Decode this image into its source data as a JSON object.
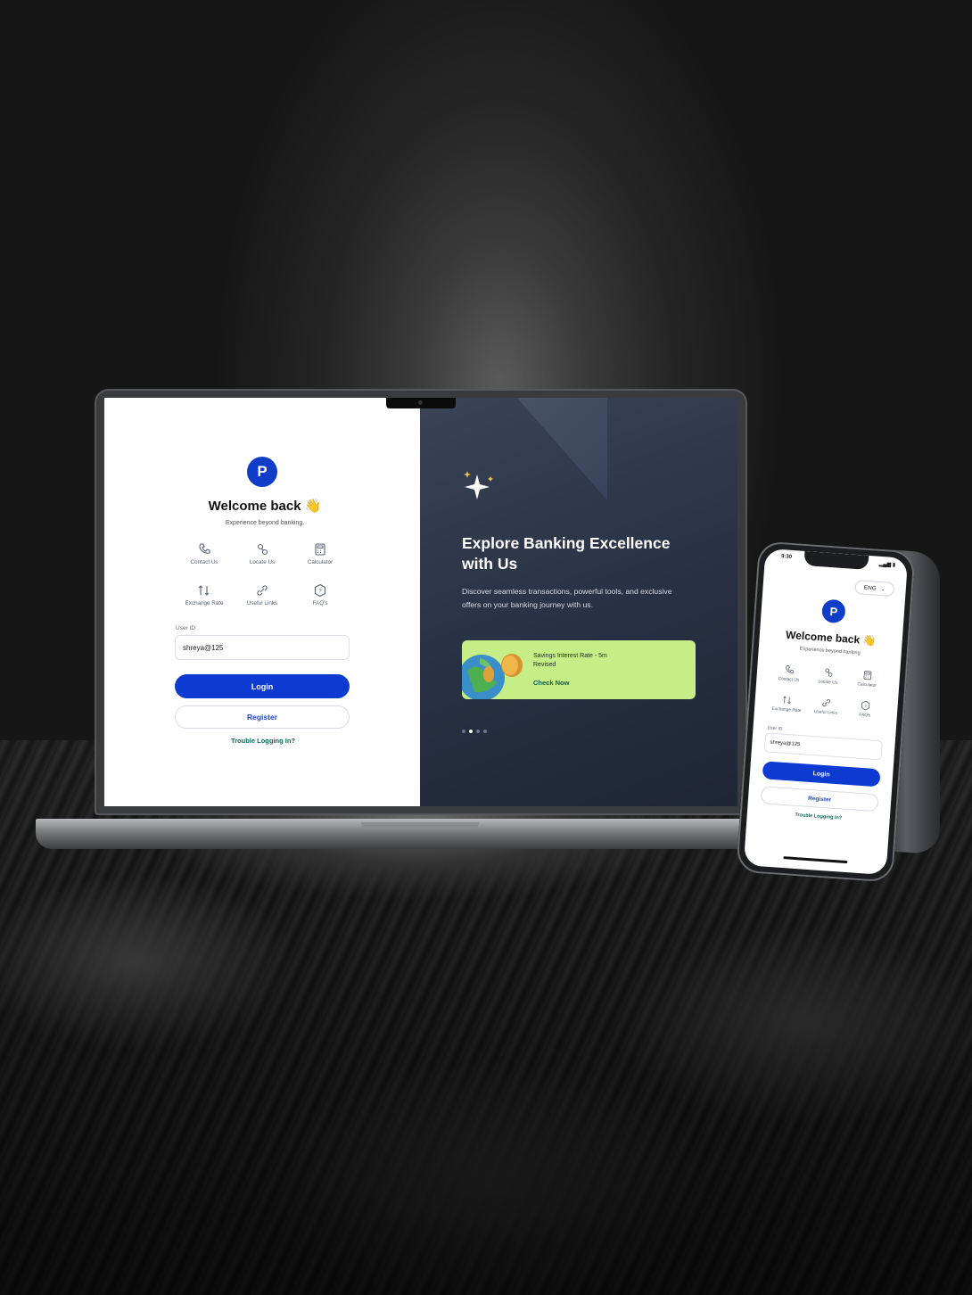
{
  "laptop": {
    "login": {
      "welcome": "Welcome back",
      "wave": "👋",
      "subtitle": "Experience beyond banking.",
      "quick_actions": [
        {
          "label": "Contact Us",
          "icon": "phone-icon"
        },
        {
          "label": "Locate Us",
          "icon": "location-icon"
        },
        {
          "label": "Calculator",
          "icon": "calculator-icon"
        },
        {
          "label": "Exchange Rate",
          "icon": "exchange-icon"
        },
        {
          "label": "Useful Links",
          "icon": "link-icon"
        },
        {
          "label": "FAQ's",
          "icon": "faq-icon"
        }
      ],
      "user_id_label": "User ID",
      "user_id_value": "shreya@125",
      "login_label": "Login",
      "register_label": "Register",
      "trouble_label": "Trouble Logging In?"
    },
    "promo": {
      "title": "Explore Banking Excellence with Us",
      "description": "Discover seamless transactions, powerful tools, and exclusive offers on your banking journey with us.",
      "banner_text": "Savings Interest Rate - 5m Revised",
      "banner_link": "Check Now",
      "dots": 4,
      "active_dot": 1
    }
  },
  "phone": {
    "time": "9:30",
    "language": "ENG",
    "welcome": "Welcome back",
    "wave": "👋",
    "subtitle": "Experience beyond banking",
    "quick_actions": [
      {
        "label": "Contact Us",
        "icon": "phone-icon"
      },
      {
        "label": "Locate Us",
        "icon": "location-icon"
      },
      {
        "label": "Calculator",
        "icon": "calculator-icon"
      },
      {
        "label": "Exchange Rate",
        "icon": "exchange-icon"
      },
      {
        "label": "Useful Links",
        "icon": "link-icon"
      },
      {
        "label": "FAQ's",
        "icon": "faq-icon"
      }
    ],
    "user_id_label": "User ID",
    "user_id_value": "shreya@125",
    "login_label": "Login",
    "register_label": "Register",
    "trouble_label": "Trouble Logging In?"
  },
  "colors": {
    "primary": "#0d3bd1",
    "promo_bg": "#283043",
    "banner_bg": "#c6ee87",
    "trouble": "#0e6a5b"
  }
}
